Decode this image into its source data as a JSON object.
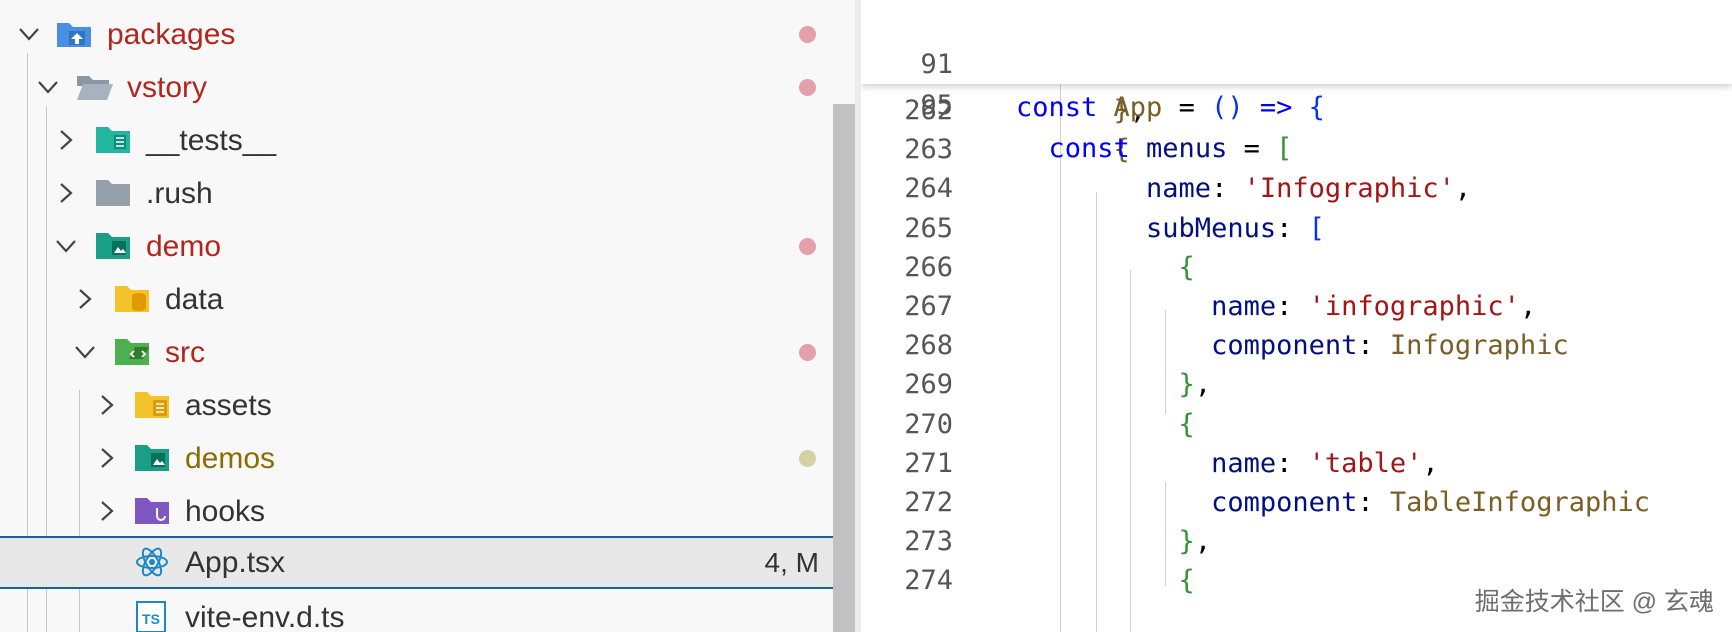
{
  "explorer": {
    "items": [
      {
        "name": "packages",
        "expanded": true,
        "icon": "folder-packages-icon",
        "color": "red",
        "dot": "#e2a0a8"
      },
      {
        "name": "vstory",
        "expanded": true,
        "icon": "folder-open-icon",
        "color": "red",
        "dot": "#e2a0a8"
      },
      {
        "name": "__tests__",
        "expanded": false,
        "icon": "folder-tests-icon",
        "color": "normal"
      },
      {
        "name": ".rush",
        "expanded": false,
        "icon": "folder-icon",
        "color": "normal"
      },
      {
        "name": "demo",
        "expanded": true,
        "icon": "folder-demo-icon",
        "color": "red",
        "dot": "#e2a0a8"
      },
      {
        "name": "data",
        "expanded": false,
        "icon": "folder-data-icon",
        "color": "normal"
      },
      {
        "name": "src",
        "expanded": true,
        "icon": "folder-src-icon",
        "color": "red",
        "dot": "#e2a0a8"
      },
      {
        "name": "assets",
        "expanded": false,
        "icon": "folder-assets-icon",
        "color": "normal"
      },
      {
        "name": "demos",
        "expanded": false,
        "icon": "folder-demos-icon",
        "color": "olive",
        "dot": "#d6d0a6"
      },
      {
        "name": "hooks",
        "expanded": false,
        "icon": "folder-hooks-icon",
        "color": "normal"
      },
      {
        "name": "App.tsx",
        "file": true,
        "icon": "react-icon",
        "color": "normal",
        "status": "4, M",
        "selected": true
      },
      {
        "name": "vite-env.d.ts",
        "file": true,
        "icon": "typescript-icon",
        "color": "normal"
      }
    ]
  },
  "editor": {
    "sticky": [
      {
        "ln": "91",
        "tokens": [
          [
            "kw",
            "const "
          ],
          [
            "fn",
            "App"
          ],
          [
            "op",
            " = "
          ],
          [
            "br3",
            "()"
          ],
          [
            "op",
            " "
          ],
          [
            "kw",
            "=>"
          ],
          [
            "op",
            " "
          ],
          [
            "br3",
            "{"
          ]
        ]
      },
      {
        "ln": "95",
        "tokens": [
          [
            "kw",
            "  const "
          ],
          [
            "id",
            "menus"
          ],
          [
            "op",
            " = "
          ],
          [
            "br2",
            "["
          ]
        ]
      }
    ],
    "lines": [
      {
        "ln": "262",
        "tokens": [
          [
            "br1",
            "      }"
          ],
          [
            "punct",
            ","
          ]
        ]
      },
      {
        "ln": "263",
        "tokens": [
          [
            "br1",
            "      {"
          ]
        ]
      },
      {
        "ln": "264",
        "tokens": [
          [
            "prop",
            "        name"
          ],
          [
            "punct",
            ": "
          ],
          [
            "str",
            "'Infographic'"
          ],
          [
            "punct",
            ","
          ]
        ]
      },
      {
        "ln": "265",
        "tokens": [
          [
            "prop",
            "        subMenus"
          ],
          [
            "punct",
            ": "
          ],
          [
            "br3",
            "["
          ]
        ]
      },
      {
        "ln": "266",
        "tokens": [
          [
            "br2",
            "          {"
          ]
        ]
      },
      {
        "ln": "267",
        "tokens": [
          [
            "prop",
            "            name"
          ],
          [
            "punct",
            ": "
          ],
          [
            "str",
            "'infographic'"
          ],
          [
            "punct",
            ","
          ]
        ]
      },
      {
        "ln": "268",
        "tokens": [
          [
            "prop",
            "            component"
          ],
          [
            "punct",
            ": "
          ],
          [
            "cls",
            "Infographic"
          ]
        ]
      },
      {
        "ln": "269",
        "tokens": [
          [
            "br2",
            "          }"
          ],
          [
            "punct",
            ","
          ]
        ]
      },
      {
        "ln": "270",
        "tokens": [
          [
            "br2",
            "          {"
          ]
        ]
      },
      {
        "ln": "271",
        "tokens": [
          [
            "prop",
            "            name"
          ],
          [
            "punct",
            ": "
          ],
          [
            "str",
            "'table'"
          ],
          [
            "punct",
            ","
          ]
        ]
      },
      {
        "ln": "272",
        "tokens": [
          [
            "prop",
            "            component"
          ],
          [
            "punct",
            ": "
          ],
          [
            "cls",
            "TableInfographic"
          ]
        ]
      },
      {
        "ln": "273",
        "tokens": [
          [
            "br2",
            "          }"
          ],
          [
            "punct",
            ","
          ]
        ]
      },
      {
        "ln": "274",
        "tokens": [
          [
            "br2",
            "          {"
          ]
        ]
      }
    ]
  },
  "watermark": "掘金技术社区 @ 玄魂"
}
